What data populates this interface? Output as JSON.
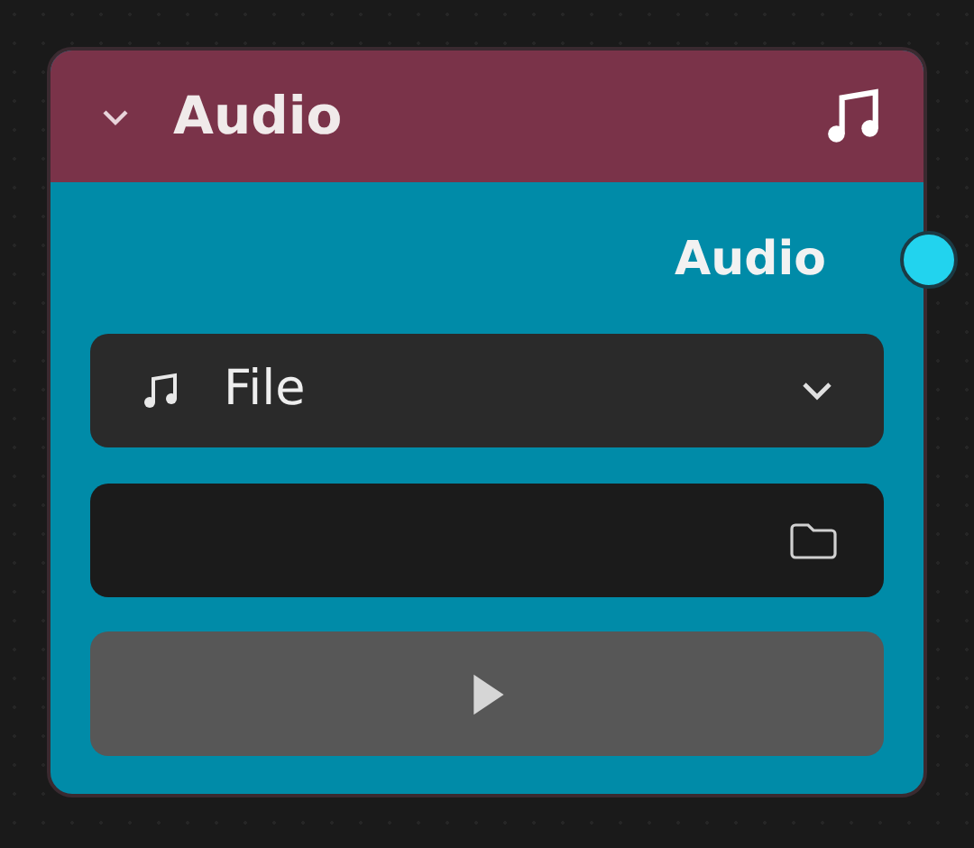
{
  "node": {
    "title": "Audio",
    "expanded": true,
    "outputs": [
      {
        "label": "Audio"
      }
    ],
    "source_dropdown": {
      "value": "File"
    }
  }
}
